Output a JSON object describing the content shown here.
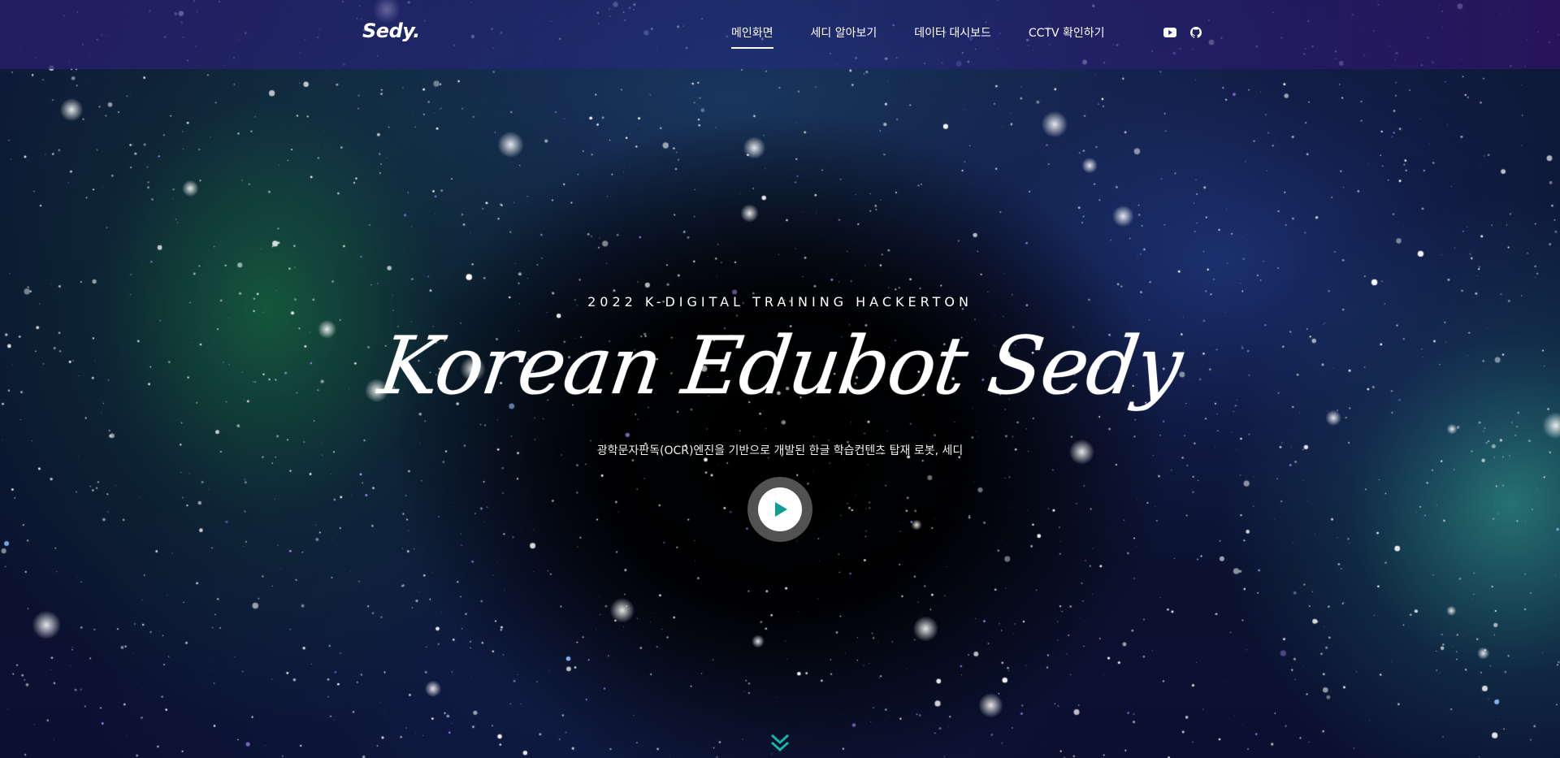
{
  "header": {
    "logo": "Sedy.",
    "nav": [
      {
        "label": "메인화면",
        "active": true
      },
      {
        "label": "세디 알아보기",
        "active": false
      },
      {
        "label": "데이터 대시보드",
        "active": false
      },
      {
        "label": "CCTV 확인하기",
        "active": false
      }
    ],
    "icons": [
      "youtube-icon",
      "github-icon"
    ]
  },
  "hero": {
    "eyebrow": "2022 K-DIGITAL TRAINING HACKERTON",
    "title": "Korean Edubot Sedy",
    "subtitle": "광학문자판독(OCR)엔진을 기반으로 개발된 한글 학습컨텐츠 탑재 로봇, 세디"
  },
  "colors": {
    "accent": "#0f9c93",
    "nav_bg": "#2b2470",
    "text": "#ffffff"
  }
}
